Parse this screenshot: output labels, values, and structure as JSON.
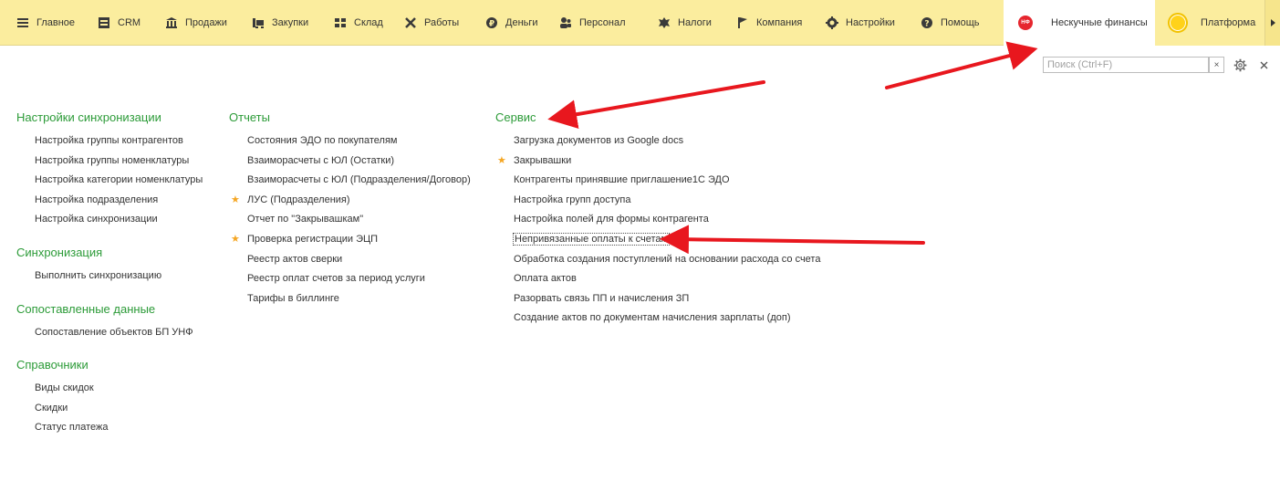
{
  "topbar": {
    "items": [
      {
        "label": "Главное",
        "icon": "menu-icon"
      },
      {
        "label": "CRM",
        "icon": "crm-icon"
      },
      {
        "label": "Продажи",
        "icon": "bank-icon"
      },
      {
        "label": "Закупки",
        "icon": "cart-icon"
      },
      {
        "label": "Склад",
        "icon": "warehouse-icon"
      },
      {
        "label": "Работы",
        "icon": "tools-icon"
      },
      {
        "label": "Деньги",
        "icon": "money-icon"
      },
      {
        "label": "Персонал",
        "icon": "people-icon"
      },
      {
        "label": "Налоги",
        "icon": "emblem-icon"
      },
      {
        "label": "Компания",
        "icon": "flag-icon"
      },
      {
        "label": "Настройки",
        "icon": "gear-icon"
      },
      {
        "label": "Помощь",
        "icon": "help-icon"
      }
    ],
    "org": {
      "label": "Нескучные финансы",
      "logo_text": "НФ",
      "logo_color": "#e6262e"
    },
    "platform": {
      "label": "Платформа"
    },
    "accent_color": "#fbed9e"
  },
  "search": {
    "placeholder": "Поиск (Ctrl+F)",
    "value": "",
    "clear_label": "×"
  },
  "sections": {
    "sync_settings": {
      "title": "Настройки синхронизации",
      "items": [
        {
          "label": "Настройка группы контрагентов"
        },
        {
          "label": "Настройка группы номенклатуры"
        },
        {
          "label": "Настройка категории номенклатуры"
        },
        {
          "label": "Настройка подразделения"
        },
        {
          "label": "Настройка синхронизации"
        }
      ]
    },
    "sync": {
      "title": "Синхронизация",
      "items": [
        {
          "label": "Выполнить синхронизацию"
        }
      ]
    },
    "matched": {
      "title": "Сопоставленные данные",
      "items": [
        {
          "label": "Сопоставление объектов БП УНФ"
        }
      ]
    },
    "refs": {
      "title": "Справочники",
      "items": [
        {
          "label": "Виды скидок"
        },
        {
          "label": "Скидки"
        },
        {
          "label": "Статус платежа"
        }
      ]
    },
    "reports": {
      "title": "Отчеты",
      "items": [
        {
          "label": "Состояния ЭДО по покупателям",
          "starred": false
        },
        {
          "label": "Взаиморасчеты с ЮЛ (Остатки)",
          "starred": false
        },
        {
          "label": "Взаиморасчеты с ЮЛ (Подразделения/Договор)",
          "starred": false
        },
        {
          "label": "ЛУС (Подразделения)",
          "starred": true
        },
        {
          "label": "Отчет по \"Закрывашкам\"",
          "starred": false
        },
        {
          "label": "Проверка регистрации ЭЦП",
          "starred": true
        },
        {
          "label": "Реестр актов сверки",
          "starred": false
        },
        {
          "label": "Реестр оплат счетов за период услуги",
          "starred": false
        },
        {
          "label": "Тарифы в биллинге",
          "starred": false
        }
      ]
    },
    "service": {
      "title": "Сервис",
      "items": [
        {
          "label": "Загрузка документов из Google docs",
          "starred": false
        },
        {
          "label": "Закрывашки",
          "starred": true
        },
        {
          "label": "Контрагенты принявшие приглашение1С ЭДО",
          "starred": false
        },
        {
          "label": "Настройка групп доступа",
          "starred": false
        },
        {
          "label": "Настройка полей для формы контрагента",
          "starred": false
        },
        {
          "label": "Непривязанные оплаты к счетам",
          "starred": false,
          "selected": true
        },
        {
          "label": "Обработка создания поступлений на основании расхода со счета",
          "starred": false
        },
        {
          "label": "Оплата актов",
          "starred": false
        },
        {
          "label": "Разорвать связь ПП и начисления ЗП",
          "starred": false
        },
        {
          "label": "Создание актов по документам начисления зарплаты (доп)",
          "starred": false
        }
      ]
    }
  },
  "colors": {
    "section_title": "#2c9b38",
    "star": "#f5a623",
    "annotation_arrow": "#e8171e"
  }
}
